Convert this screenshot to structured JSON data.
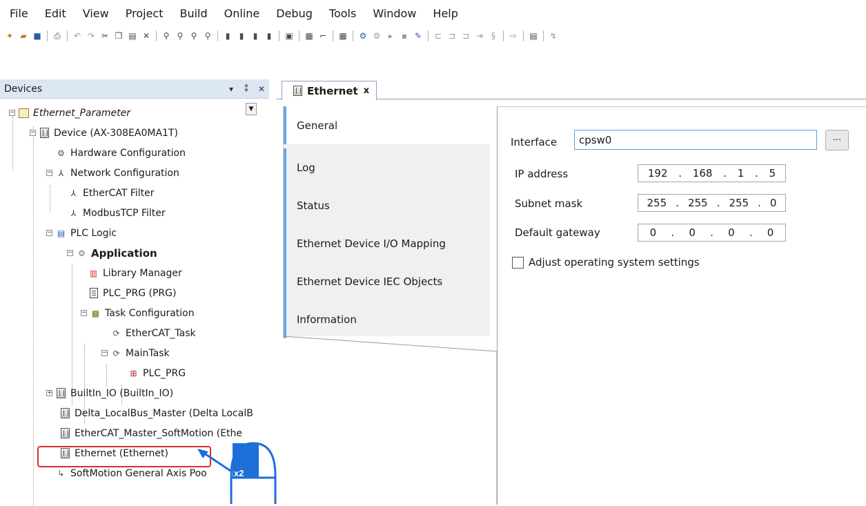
{
  "menu": [
    "File",
    "Edit",
    "View",
    "Project",
    "Build",
    "Online",
    "Debug",
    "Tools",
    "Window",
    "Help"
  ],
  "devices_pane": {
    "title": "Devices",
    "controls": [
      "▾",
      "⁑",
      "✕"
    ]
  },
  "tree": [
    {
      "label": "Ethernet_Parameter",
      "italic": true
    },
    {
      "label": "Device (AX-308EA0MA1T)"
    },
    {
      "label": "Hardware Configuration"
    },
    {
      "label": "Network Configuration"
    },
    {
      "label": "EtherCAT Filter"
    },
    {
      "label": "ModbusTCP Filter"
    },
    {
      "label": "PLC Logic"
    },
    {
      "label": "Application",
      "bold": true
    },
    {
      "label": "Library Manager"
    },
    {
      "label": "PLC_PRG (PRG)"
    },
    {
      "label": "Task Configuration"
    },
    {
      "label": "EtherCAT_Task"
    },
    {
      "label": "MainTask"
    },
    {
      "label": "PLC_PRG"
    },
    {
      "label": "BuiltIn_IO (BuiltIn_IO)"
    },
    {
      "label": "Delta_LocalBus_Master (Delta LocalB"
    },
    {
      "label": "EtherCAT_Master_SoftMotion (Ethe"
    },
    {
      "label": "Ethernet (Ethernet)"
    },
    {
      "label": "SoftMotion General Axis Poo"
    }
  ],
  "callout": {
    "label": "x2"
  },
  "editor": {
    "tab_title": "Ethernet",
    "tab_close": "x",
    "vtabs": [
      "General",
      "Log",
      "Status",
      "Ethernet Device I/O Mapping",
      "Ethernet Device IEC Objects",
      "Information"
    ],
    "general": {
      "interface_label": "Interface",
      "interface_value": "cpsw0",
      "browse_label": "...",
      "ip_label": "IP address",
      "ip_value": [
        "192",
        "168",
        "1",
        "5"
      ],
      "subnet_label": "Subnet mask",
      "subnet_value": [
        "255",
        "255",
        "255",
        "0"
      ],
      "gateway_label": "Default gateway",
      "gateway_value": [
        "0",
        "0",
        "0",
        "0"
      ],
      "adjust_label": "Adjust operating system settings",
      "adjust_checked": false
    }
  },
  "colors": {
    "pane_header": "#dde7f3",
    "tab_accent": "#62a8e6",
    "highlight": "#e02a2a",
    "callout": "#1e6ed8"
  }
}
